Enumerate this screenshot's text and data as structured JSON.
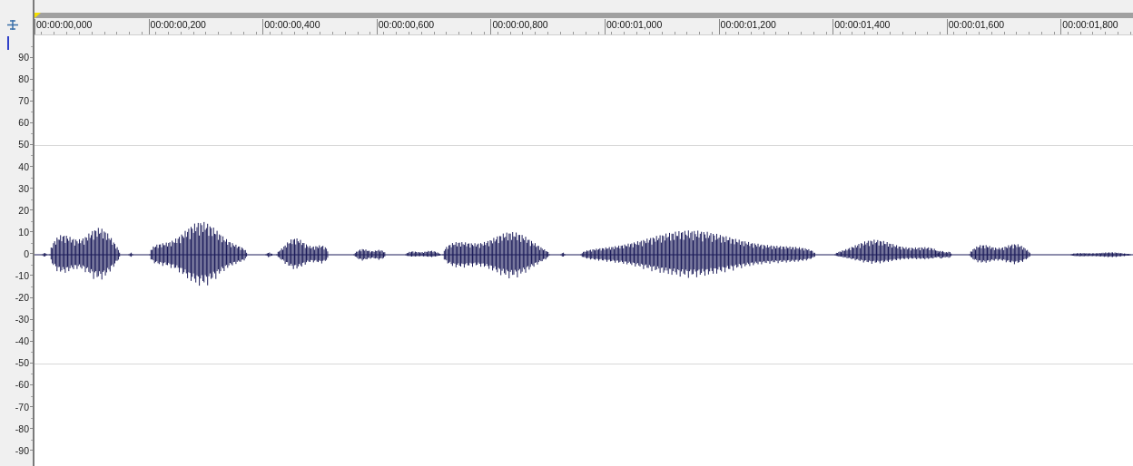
{
  "ruler": {
    "labels": [
      "00:00:00,000",
      "00:00:00,200",
      "00:00:00,400",
      "00:00:00,600",
      "00:00:00,800",
      "00:00:01,000",
      "00:00:01,200",
      "00:00:01,400",
      "00:00:01,600",
      "00:00:01,800"
    ]
  },
  "y_axis": {
    "labels": [
      "90",
      "80",
      "70",
      "60",
      "50",
      "40",
      "30",
      "20",
      "10",
      "0",
      "-10",
      "-20",
      "-30",
      "-40",
      "-50",
      "-60",
      "-70",
      "-80",
      "-90"
    ]
  }
}
